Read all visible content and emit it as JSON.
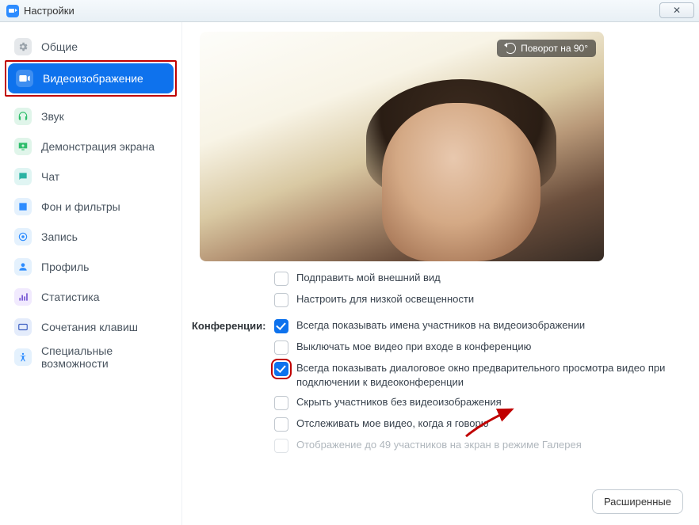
{
  "titlebar": {
    "title": "Настройки",
    "close_label": "✕"
  },
  "sidebar": {
    "items": [
      {
        "label": "Общие"
      },
      {
        "label": "Видеоизображение"
      },
      {
        "label": "Звук"
      },
      {
        "label": "Демонстрация экрана"
      },
      {
        "label": "Чат"
      },
      {
        "label": "Фон и фильтры"
      },
      {
        "label": "Запись"
      },
      {
        "label": "Профиль"
      },
      {
        "label": "Статистика"
      },
      {
        "label": "Сочетания клавиш"
      },
      {
        "label": "Специальные возможности"
      }
    ]
  },
  "video": {
    "rotate_label": "Поворот на 90°",
    "option_touch_up": "Подправить мой внешний вид",
    "option_low_light": "Настроить для низкой освещенности"
  },
  "meetings": {
    "section_label": "Конференции:",
    "options": [
      {
        "label": "Всегда показывать имена участников на видеоизображении",
        "checked": true
      },
      {
        "label": "Выключать мое видео при входе в конференцию",
        "checked": false
      },
      {
        "label": "Всегда показывать диалоговое окно предварительного просмотра видео при подключении к видеоконференции",
        "checked": true,
        "highlight": true
      },
      {
        "label": "Скрыть участников без видеоизображения",
        "checked": false
      },
      {
        "label": "Отслеживать мое видео, когда я говорю",
        "checked": false
      },
      {
        "label": "Отображение до 49 участников на экран в режиме Галерея",
        "checked": false,
        "disabled": true
      }
    ]
  },
  "footer": {
    "advanced_label": "Расширенные"
  }
}
